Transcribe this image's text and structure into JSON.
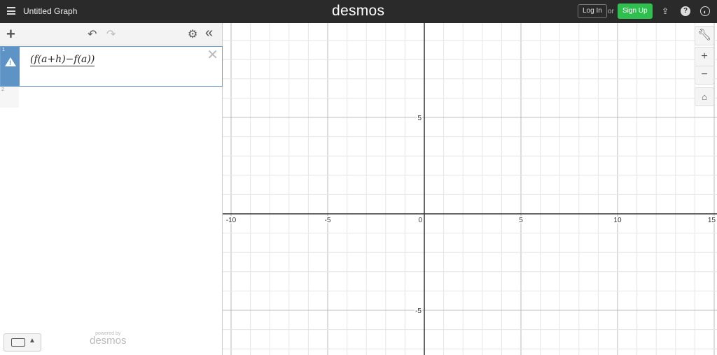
{
  "topbar": {
    "title": "Untitled Graph",
    "logo": "desmos",
    "login": "Log In",
    "or": "or",
    "signup": "Sign Up",
    "signup_color": "#2fbf4f"
  },
  "panel": {
    "add": "+",
    "undo": "↶",
    "redo": "↷",
    "settings": "⚙",
    "collapse": "«",
    "expressions": [
      {
        "index": "1",
        "latex": "(f(a+h)−f(a))",
        "status": "warning"
      },
      {
        "index": "2",
        "latex": ""
      }
    ],
    "powered_by": "powered by",
    "powered_logo": "desmos"
  },
  "graph": {
    "x_ticks": [
      "-10",
      "-5",
      "0",
      "5",
      "10",
      "15"
    ],
    "y_ticks": [
      "5",
      "-5"
    ],
    "zoom_in": "+",
    "zoom_out": "−"
  }
}
